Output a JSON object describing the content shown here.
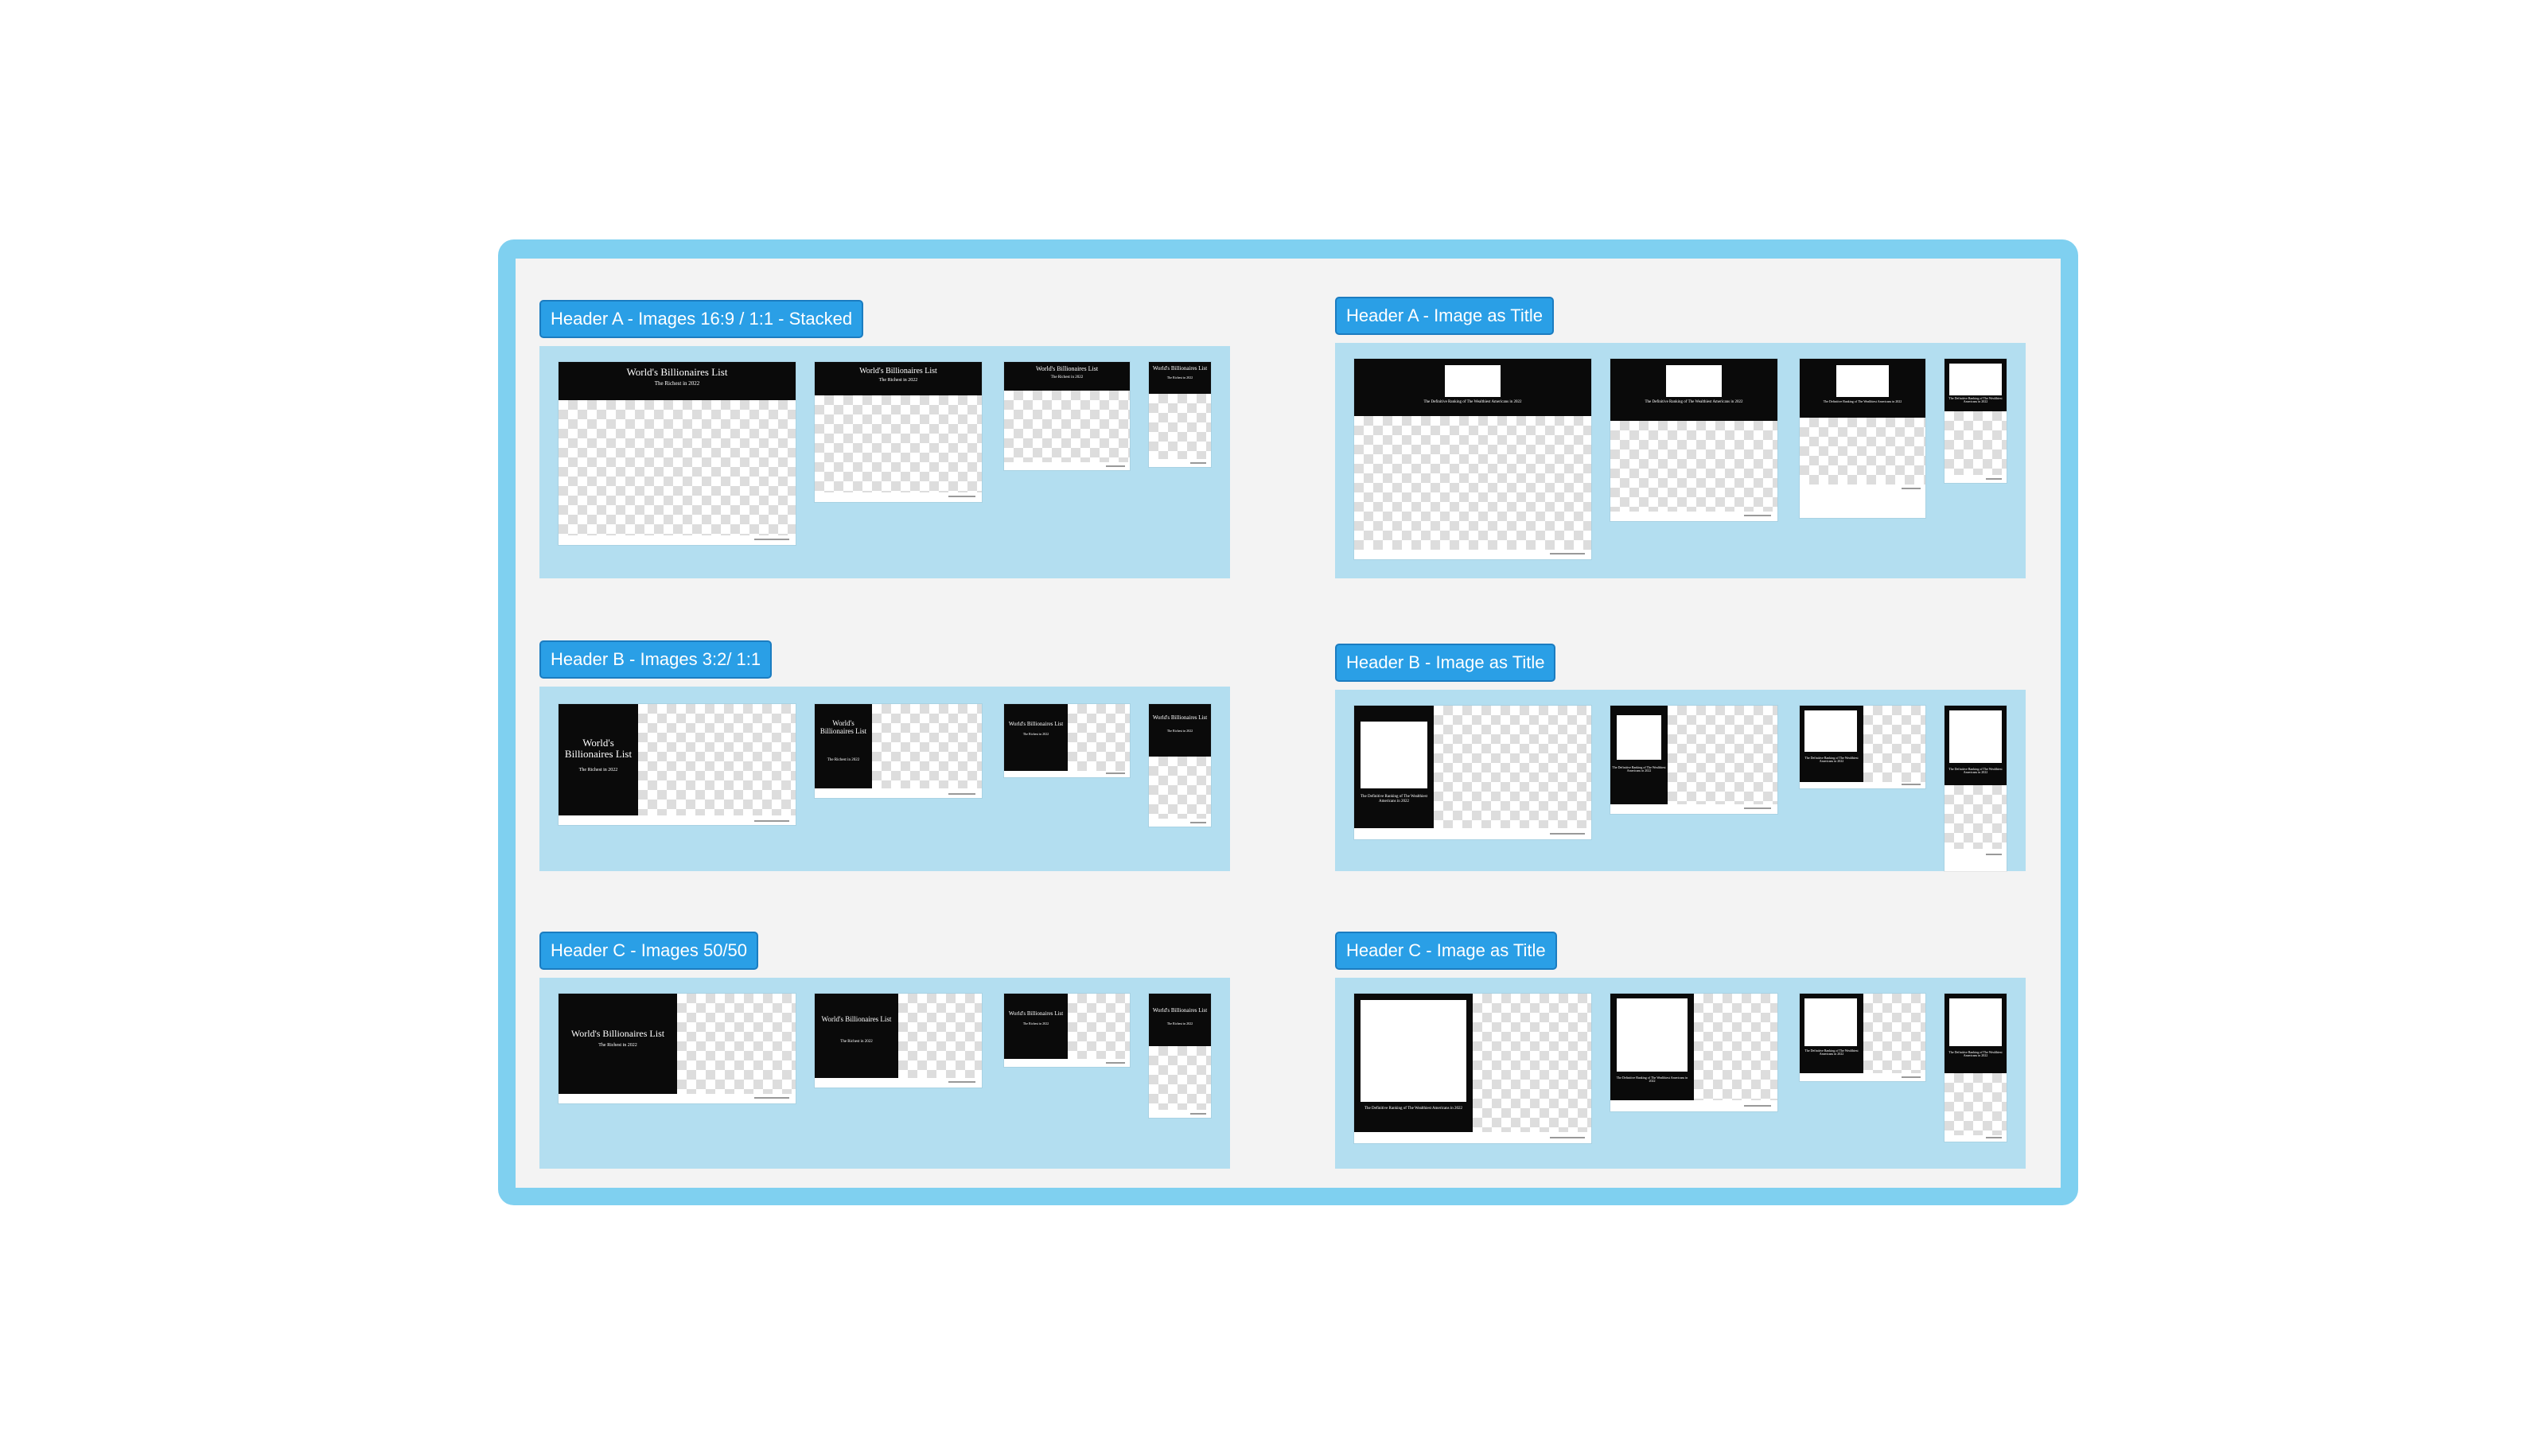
{
  "sections": {
    "a_stacked": {
      "label": "Header A - Images 16:9 / 1:1 - Stacked"
    },
    "a_title": {
      "label": "Header A - Image as Title"
    },
    "b_images": {
      "label": "Header B - Images 3:2/ 1:1"
    },
    "b_title": {
      "label": "Header B - Image as Title"
    },
    "c_images": {
      "label": "Header C - Images 50/50"
    },
    "c_title": {
      "label": "Header C - Image as Title"
    }
  },
  "thumb_text": {
    "headline": "World's Billionaires List",
    "subhead": "The Richest in 2022",
    "ranking": "The Definitive Ranking of The Wealthiest Americans in 2022"
  },
  "colors": {
    "frame": "#7fd0f0",
    "canvas": "#f3f3f3",
    "panel": "#b3def0",
    "tag": "#2a9fe6",
    "header_dark": "#0a0a0a"
  }
}
